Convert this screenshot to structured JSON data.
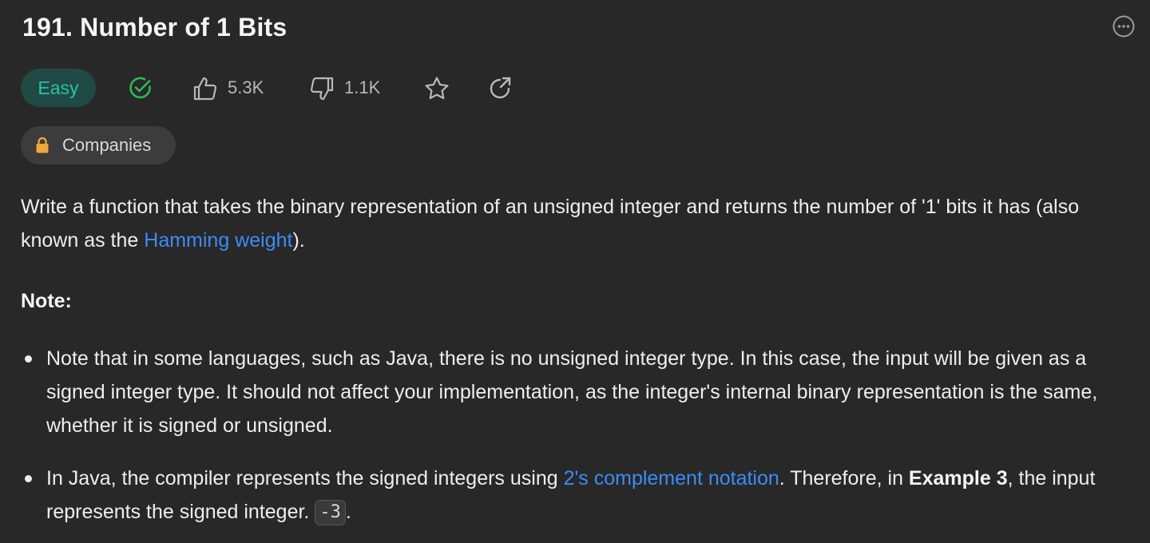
{
  "problem": {
    "title": "191. Number of 1 Bits",
    "difficulty": "Easy",
    "likes": "5.3K",
    "dislikes": "1.1K",
    "companies_label": "Companies",
    "colors": {
      "easy_text": "#2dbfa8",
      "easy_bg": "#1f4a44",
      "solved_check": "#2cbb5d",
      "link": "#3b8cf5",
      "lock": "#f0a83a"
    },
    "icons": {
      "more": "more-horizontal-icon",
      "solved": "check-circle-icon",
      "like": "thumbs-up-icon",
      "dislike": "thumbs-down-icon",
      "favorite": "star-icon",
      "share": "share-icon",
      "lock": "lock-icon"
    }
  },
  "description": {
    "intro_before_link": "Write a function that takes the binary representation of an unsigned integer and returns the number of '1' bits it has (also known as the ",
    "intro_link": "Hamming weight",
    "intro_after_link": ").",
    "note_heading": "Note:",
    "note1": "Note that in some languages, such as Java, there is no unsigned integer type. In this case, the input will be given as a signed integer type. It should not affect your implementation, as the integer's internal binary representation is the same, whether it is signed or unsigned.",
    "note2_before_link": "In Java, the compiler represents the signed integers using ",
    "note2_link": "2's complement notation",
    "note2_after_link": ". Therefore, in ",
    "note2_bold": "Example 3",
    "note2_after_bold": ", the input represents the signed integer. ",
    "note2_code": "-3",
    "note2_end": "."
  }
}
